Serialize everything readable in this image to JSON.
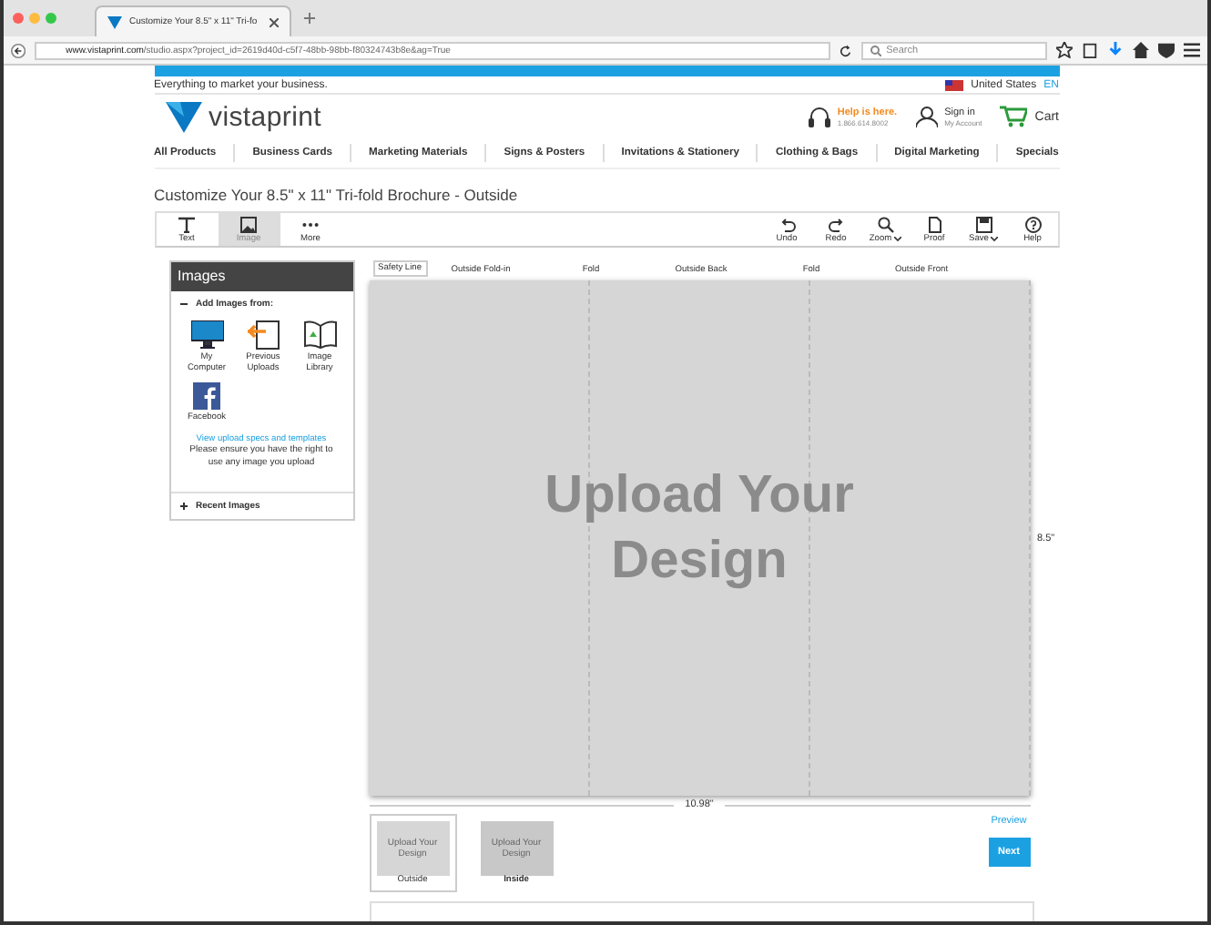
{
  "browser": {
    "tab_title": "Customize Your 8.5\" x 11\" Tri-fo",
    "url_host": "www.vistaprint.com",
    "url_path": "/studio.aspx?project_id=2619d40d-c5f7-48bb-98bb-f80324743b8e&ag=True",
    "search_placeholder": "Search"
  },
  "header": {
    "tagline": "Everything to market your business.",
    "country": "United States",
    "language": "EN",
    "logo": "vistaprint",
    "help_title": "Help is here.",
    "help_phone": "1.866.614.8002",
    "sign_in": "Sign in",
    "account": "My Account",
    "cart": "Cart"
  },
  "nav": [
    "All Products",
    "Business Cards",
    "Marketing Materials",
    "Signs & Posters",
    "Invitations & Stationery",
    "Clothing & Bags",
    "Digital Marketing",
    "Specials"
  ],
  "page_title": "Customize Your 8.5\" x 11\" Tri-fold Brochure - Outside",
  "tools_left": [
    {
      "kind": "text",
      "label": "Text",
      "selected": false
    },
    {
      "kind": "image",
      "label": "Image",
      "selected": true
    },
    {
      "kind": "more",
      "label": "More",
      "selected": false
    }
  ],
  "tools_right": [
    {
      "kind": "undo",
      "label": "Undo",
      "dropdown": false
    },
    {
      "kind": "redo",
      "label": "Redo",
      "dropdown": false
    },
    {
      "kind": "zoom",
      "label": "Zoom",
      "dropdown": true
    },
    {
      "kind": "proof",
      "label": "Proof",
      "dropdown": false
    },
    {
      "kind": "save",
      "label": "Save",
      "dropdown": true
    },
    {
      "kind": "help",
      "label": "Help",
      "dropdown": false
    }
  ],
  "panel": {
    "title": "Images",
    "section": "Add Images from:",
    "expanded": true,
    "sources": [
      {
        "kind": "computer",
        "label": "My Computer"
      },
      {
        "kind": "uploads",
        "label": "Previous Uploads"
      },
      {
        "kind": "library",
        "label": "Image Library"
      },
      {
        "kind": "facebook",
        "label": "Facebook"
      }
    ],
    "link": "View upload specs and templates",
    "note": "Please ensure you have the right to use any image you upload",
    "recent": "Recent Images"
  },
  "canvas": {
    "safety_line": "Safety Line",
    "labels": [
      "Outside Fold-in",
      "Fold",
      "Outside Back",
      "Fold",
      "Outside Front"
    ],
    "placeholder": "Upload Your Design",
    "height": "8.5\"",
    "width": "10.98\""
  },
  "pages": [
    {
      "label": "Outside",
      "placeholder": "Upload Your Design",
      "selected": true
    },
    {
      "label": "Inside",
      "placeholder": "Upload Your Design",
      "selected": false
    }
  ],
  "preview": "Preview",
  "next": "Next"
}
